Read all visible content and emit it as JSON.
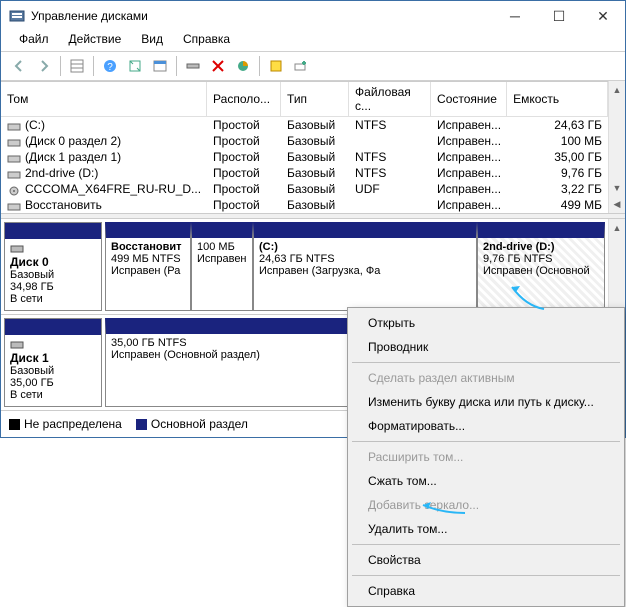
{
  "window": {
    "title": "Управление дисками"
  },
  "menu": {
    "file": "Файл",
    "action": "Действие",
    "view": "Вид",
    "help": "Справка"
  },
  "table": {
    "cols": {
      "volume": "Том",
      "layout": "Располо...",
      "type": "Тип",
      "fs": "Файловая с...",
      "status": "Состояние",
      "cap": "Емкость"
    },
    "rows": [
      {
        "volume": "(C:)",
        "layout": "Простой",
        "type": "Базовый",
        "fs": "NTFS",
        "status": "Исправен...",
        "cap": "24,63 ГБ"
      },
      {
        "volume": "(Диск 0 раздел 2)",
        "layout": "Простой",
        "type": "Базовый",
        "fs": "",
        "status": "Исправен...",
        "cap": "100 МБ"
      },
      {
        "volume": "(Диск 1 раздел 1)",
        "layout": "Простой",
        "type": "Базовый",
        "fs": "NTFS",
        "status": "Исправен...",
        "cap": "35,00 ГБ"
      },
      {
        "volume": "2nd-drive (D:)",
        "layout": "Простой",
        "type": "Базовый",
        "fs": "NTFS",
        "status": "Исправен...",
        "cap": "9,76 ГБ"
      },
      {
        "volume": "CCCOMA_X64FRE_RU-RU_D...",
        "layout": "Простой",
        "type": "Базовый",
        "fs": "UDF",
        "status": "Исправен...",
        "cap": "3,22 ГБ"
      },
      {
        "volume": "Восстановить",
        "layout": "Простой",
        "type": "Базовый",
        "fs": "",
        "status": "Исправен...",
        "cap": "499 МБ"
      }
    ]
  },
  "disks": {
    "d0": {
      "name": "Диск 0",
      "type": "Базовый",
      "size": "34,98 ГБ",
      "state": "В сети",
      "p0": {
        "name": "Восстановит",
        "size": "499 МБ NTFS",
        "stat": "Исправен (Ра"
      },
      "p1": {
        "name": "",
        "size": "100 МБ",
        "stat": "Исправен"
      },
      "p2": {
        "name": "(C:)",
        "size": "24,63 ГБ NTFS",
        "stat": "Исправен (Загрузка, Фа"
      },
      "p3": {
        "name": "2nd-drive (D:)",
        "size": "9,76 ГБ NTFS",
        "stat": "Исправен (Основной"
      }
    },
    "d1": {
      "name": "Диск 1",
      "type": "Базовый",
      "size": "35,00 ГБ",
      "state": "В сети",
      "p0": {
        "name": "",
        "size": "35,00 ГБ NTFS",
        "stat": "Исправен (Основной раздел)"
      }
    }
  },
  "legend": {
    "unalloc": "Не распределена",
    "primary": "Основной раздел"
  },
  "ctx": {
    "open": "Открыть",
    "explorer": "Проводник",
    "active": "Сделать раздел активным",
    "letter": "Изменить букву диска или путь к диску...",
    "format": "Форматировать...",
    "extend": "Расширить том...",
    "shrink": "Сжать том...",
    "mirror": "Добавить зеркало...",
    "delete": "Удалить том...",
    "props": "Свойства",
    "help": "Справка"
  }
}
